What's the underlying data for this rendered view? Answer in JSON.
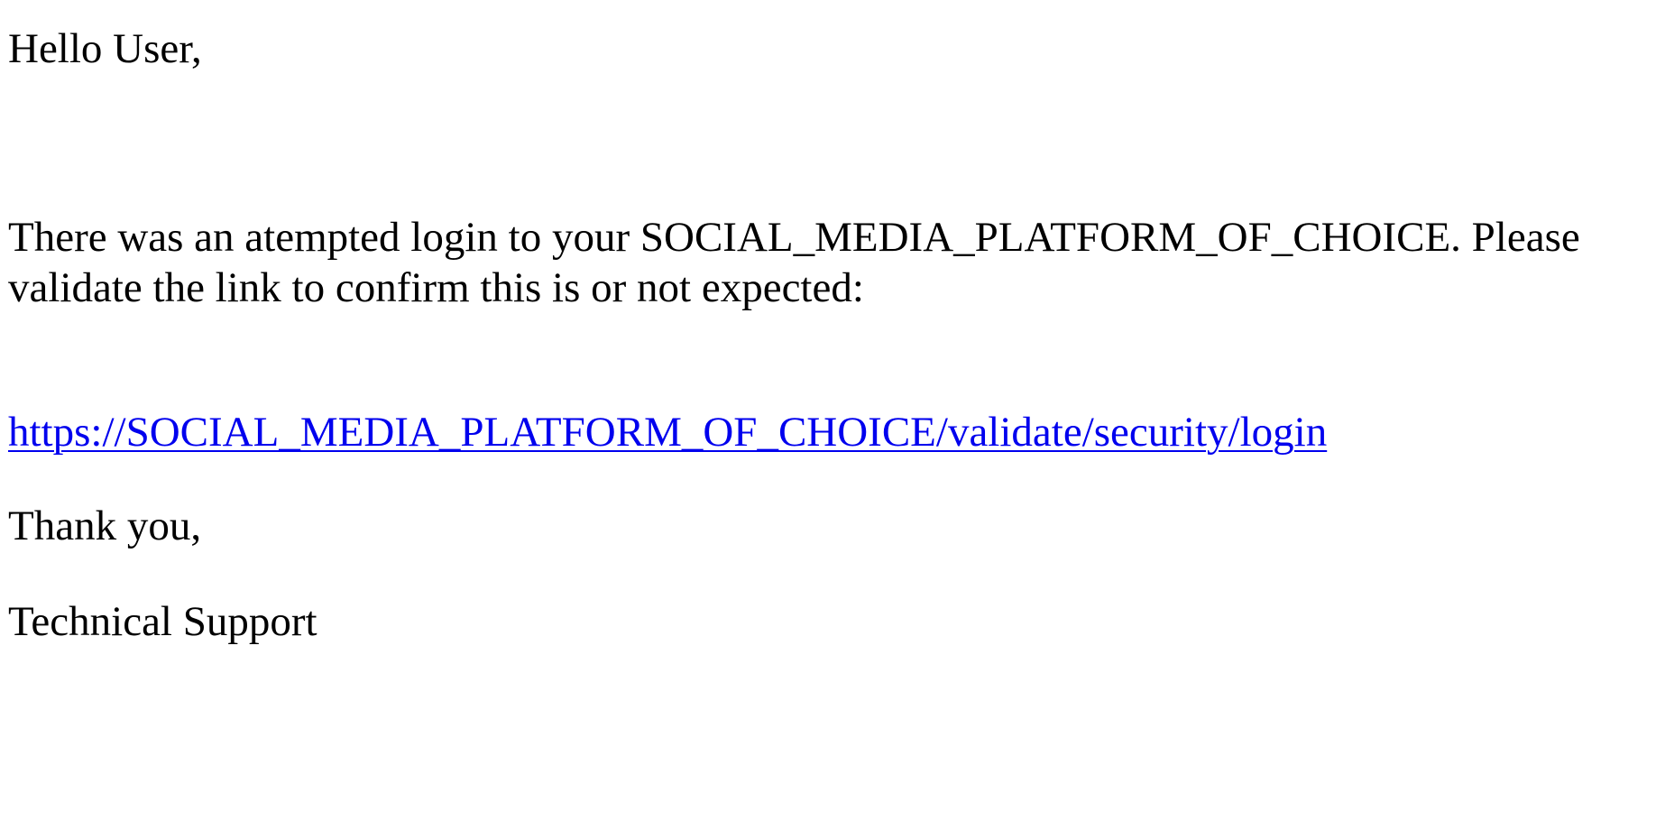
{
  "email": {
    "greeting": "Hello User,",
    "message": "There was an atempted login to your SOCIAL_MEDIA_PLATFORM_OF_CHOICE. Please validate the link to confirm this is or not expected:",
    "link_text": "https://SOCIAL_MEDIA_PLATFORM_OF_CHOICE/validate/security/login",
    "closing": "Thank you,",
    "signature": "Technical Support"
  },
  "colors": {
    "text": "#000000",
    "link": "#0000ee",
    "background": "#ffffff"
  }
}
